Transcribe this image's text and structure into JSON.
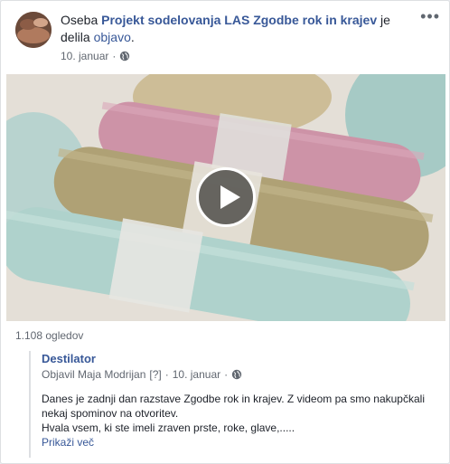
{
  "post": {
    "prefix": "Oseba",
    "group_name": "Projekt sodelovanja LAS Zgodbe rok in krajev",
    "shared_text": "je delila",
    "object_link": "objavo",
    "suffix": ".",
    "date": "10. januar",
    "separator": "·",
    "privacy_icon": "globe-icon",
    "more_label": "•••"
  },
  "video": {
    "play_icon": "play-icon",
    "views": "1.108 ogledov"
  },
  "shared_post": {
    "page_name": "Destilator",
    "author_prefix": "Objavil Maja Modrijan",
    "help_marker": "[?]",
    "separator": "·",
    "date": "10. januar",
    "privacy_icon": "globe-icon",
    "line1": "Danes je zadnji dan razstave Zgodbe rok in krajev. Z videom pa smo nakupčkali nekaj spominov na otvoritev.",
    "line2": "Hvala vsem, ki ste imeli zraven prste, roke, glave,.....",
    "see_more": "Prikaži več"
  },
  "colors": {
    "link": "#385898",
    "secondary_text": "#616770",
    "rug_pink": "#c98aa0",
    "rug_jute": "#a99a6a",
    "rug_aqua": "#a9cfc8"
  }
}
